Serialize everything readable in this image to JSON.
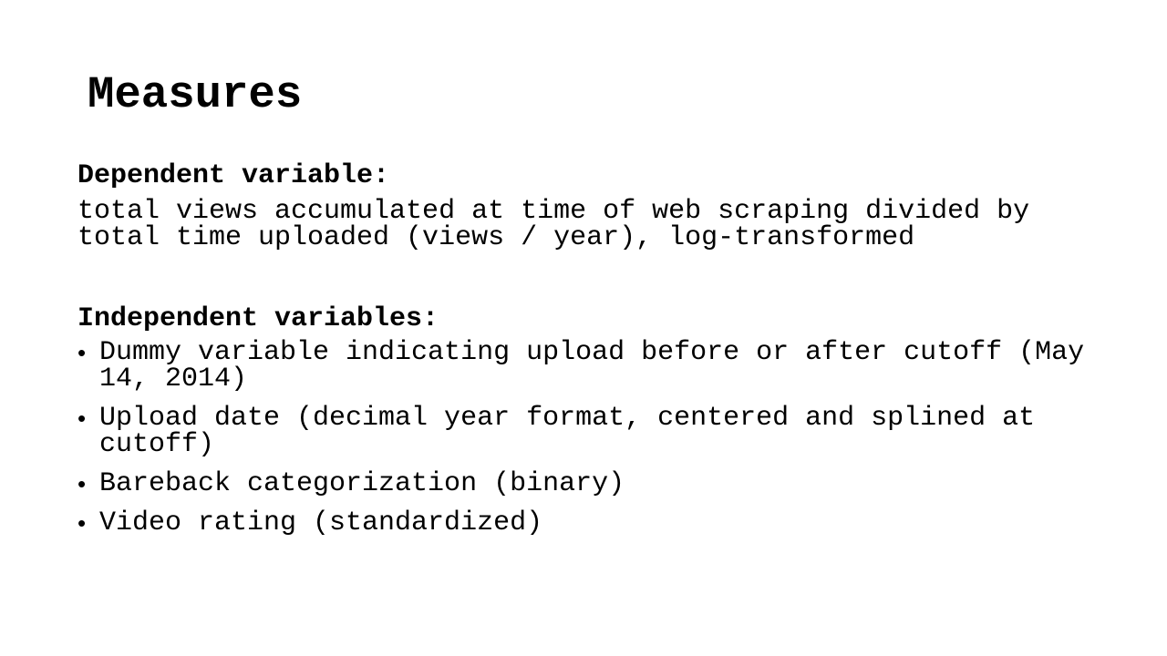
{
  "slide": {
    "title": "Measures",
    "dependent": {
      "heading": "Dependent variable:",
      "text": "total views accumulated at time of web scraping divided by total time uploaded (views / year), log-transformed"
    },
    "independent": {
      "heading": "Independent variables:",
      "bullet_glyph": "•",
      "items": [
        "Dummy variable indicating upload before or after cutoff (May 14, 2014)",
        "Upload date (decimal year format, centered and splined at cutoff)",
        "Bareback categorization (binary)",
        "Video rating (standardized)"
      ]
    }
  }
}
